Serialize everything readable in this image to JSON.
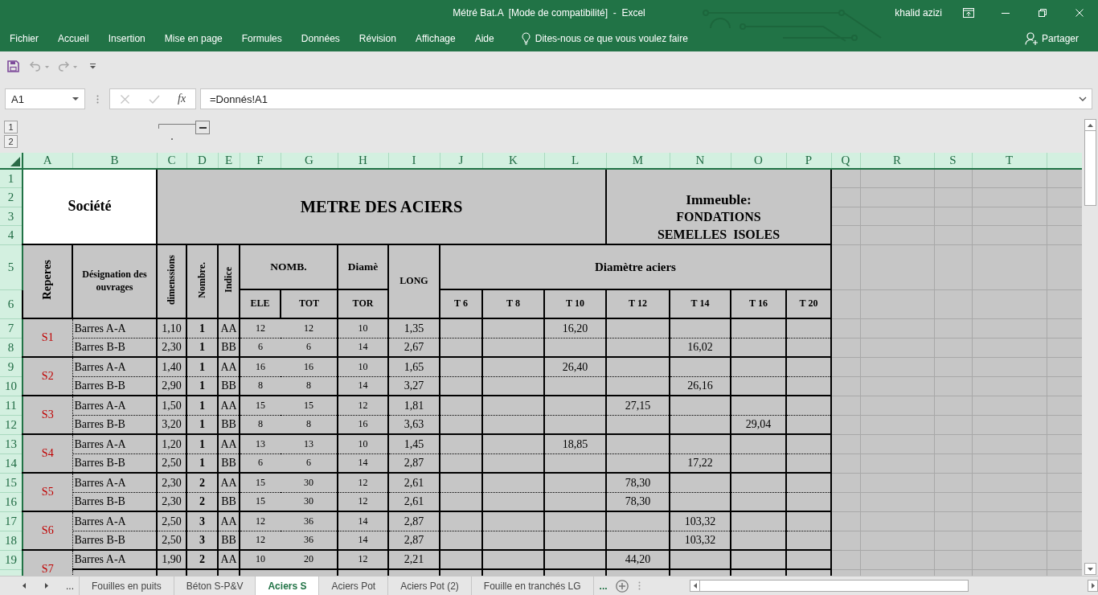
{
  "window": {
    "title": "Métré Bat.A  [Mode de compatibilité]  -  Excel",
    "user": "khalid azizi"
  },
  "ribbon": {
    "tabs": [
      "Fichier",
      "Accueil",
      "Insertion",
      "Mise en page",
      "Formules",
      "Données",
      "Révision",
      "Affichage",
      "Aide"
    ],
    "tell_me": "Dites-nous ce que vous voulez faire",
    "share": "Partager"
  },
  "quick_access": {
    "undo": {
      "disabled": true
    },
    "redo": {
      "disabled": true
    }
  },
  "formula_bar": {
    "name_box": "A1",
    "cancel": {
      "disabled": true
    },
    "enter": {
      "disabled": true
    },
    "function_label": "fx",
    "formula": "=Donnés!A1"
  },
  "outline": {
    "levels": [
      "1",
      "2"
    ],
    "expanded": true
  },
  "grid": {
    "columns": [
      "A",
      "B",
      "C",
      "D",
      "E",
      "F",
      "G",
      "H",
      "I",
      "J",
      "K",
      "L",
      "M",
      "N",
      "O",
      "P",
      "Q",
      "R",
      "S",
      "T"
    ],
    "rows": [
      "1",
      "2",
      "3",
      "4",
      "5",
      "6",
      "7",
      "8",
      "9",
      "10",
      "11",
      "12",
      "13",
      "14",
      "15",
      "16",
      "17",
      "18",
      "19"
    ]
  },
  "sheet": {
    "company": "Société",
    "title": "METRE DES ACIERS",
    "building": [
      "Immeuble:",
      "FONDATIONS",
      "SEMELLES  ISOLES"
    ],
    "headers": {
      "repere": "Reperes",
      "designation": "Désignation des ouvrages",
      "dimensions": "dimenssions",
      "count": "Nombre.",
      "index": "Indice",
      "bars_group": "NOMB.",
      "bars": [
        "ELE",
        "TOT"
      ],
      "diameter_group": "Diamè",
      "diameter": "TOR",
      "length": "LONG",
      "steel_group": "Diamètre aciers",
      "steel": [
        "T 6",
        "T 8",
        "T 10",
        "T 12",
        "T 14",
        "T 16",
        "T 20"
      ]
    },
    "elements": [
      {
        "repere": "S1",
        "lines": [
          {
            "designation": "Barres A-A",
            "dimension": "1,10",
            "count": "1",
            "index": "AA",
            "ele": "12",
            "tot": "12",
            "tor": "10",
            "length": "1,35",
            "steel": {
              "t10": "16,20"
            }
          },
          {
            "designation": "Barres B-B",
            "dimension": "2,30",
            "count": "1",
            "index": "BB",
            "ele": "6",
            "tot": "6",
            "tor": "14",
            "length": "2,67",
            "steel": {
              "t14": "16,02"
            }
          }
        ]
      },
      {
        "repere": "S2",
        "lines": [
          {
            "designation": "Barres A-A",
            "dimension": "1,40",
            "count": "1",
            "index": "AA",
            "ele": "16",
            "tot": "16",
            "tor": "10",
            "length": "1,65",
            "steel": {
              "t10": "26,40"
            }
          },
          {
            "designation": "Barres B-B",
            "dimension": "2,90",
            "count": "1",
            "index": "BB",
            "ele": "8",
            "tot": "8",
            "tor": "14",
            "length": "3,27",
            "steel": {
              "t14": "26,16"
            }
          }
        ]
      },
      {
        "repere": "S3",
        "lines": [
          {
            "designation": "Barres A-A",
            "dimension": "1,50",
            "count": "1",
            "index": "AA",
            "ele": "15",
            "tot": "15",
            "tor": "12",
            "length": "1,81",
            "steel": {
              "t12": "27,15"
            }
          },
          {
            "designation": "Barres B-B",
            "dimension": "3,20",
            "count": "1",
            "index": "BB",
            "ele": "8",
            "tot": "8",
            "tor": "16",
            "length": "3,63",
            "steel": {
              "t16": "29,04"
            }
          }
        ]
      },
      {
        "repere": "S4",
        "lines": [
          {
            "designation": "Barres A-A",
            "dimension": "1,20",
            "count": "1",
            "index": "AA",
            "ele": "13",
            "tot": "13",
            "tor": "10",
            "length": "1,45",
            "steel": {
              "t10": "18,85"
            }
          },
          {
            "designation": "Barres B-B",
            "dimension": "2,50",
            "count": "1",
            "index": "BB",
            "ele": "6",
            "tot": "6",
            "tor": "14",
            "length": "2,87",
            "steel": {
              "t14": "17,22"
            }
          }
        ]
      },
      {
        "repere": "S5",
        "lines": [
          {
            "designation": "Barres A-A",
            "dimension": "2,30",
            "count": "2",
            "index": "AA",
            "ele": "15",
            "tot": "30",
            "tor": "12",
            "length": "2,61",
            "steel": {
              "t12": "78,30"
            }
          },
          {
            "designation": "Barres B-B",
            "dimension": "2,30",
            "count": "2",
            "index": "BB",
            "ele": "15",
            "tot": "30",
            "tor": "12",
            "length": "2,61",
            "steel": {
              "t12": "78,30"
            }
          }
        ]
      },
      {
        "repere": "S6",
        "lines": [
          {
            "designation": "Barres A-A",
            "dimension": "2,50",
            "count": "3",
            "index": "AA",
            "ele": "12",
            "tot": "36",
            "tor": "14",
            "length": "2,87",
            "steel": {
              "t14": "103,32"
            }
          },
          {
            "designation": "Barres B-B",
            "dimension": "2,50",
            "count": "3",
            "index": "BB",
            "ele": "12",
            "tot": "36",
            "tor": "14",
            "length": "2,87",
            "steel": {
              "t14": "103,32"
            }
          }
        ]
      },
      {
        "repere": "S7",
        "lines": [
          {
            "designation": "Barres A-A",
            "dimension": "1,90",
            "count": "2",
            "index": "AA",
            "ele": "10",
            "tot": "20",
            "tor": "12",
            "length": "2,21",
            "steel": {
              "t12": "44,20"
            }
          }
        ]
      }
    ]
  },
  "sheet_tabs": {
    "more_left": "...",
    "tabs": [
      {
        "label": "Fouilles en puits",
        "selected": false
      },
      {
        "label": "Béton S-P&V",
        "selected": false
      },
      {
        "label": "Aciers S",
        "selected": true
      },
      {
        "label": "Aciers Pot",
        "selected": false
      },
      {
        "label": "Aciers Pot (2)",
        "selected": false
      },
      {
        "label": "Fouille en tranchés LG",
        "selected": false
      }
    ],
    "more_right": "..."
  }
}
